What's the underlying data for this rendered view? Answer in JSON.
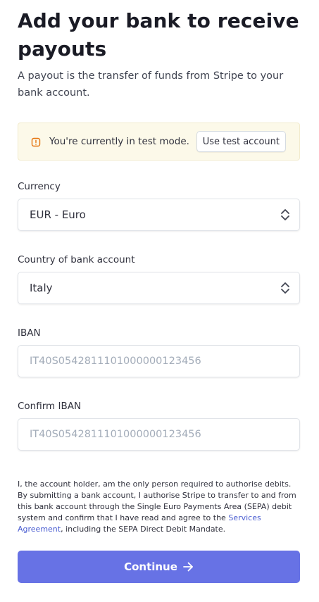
{
  "header": {
    "title": "Add your bank to receive payouts",
    "subtitle": "A payout is the transfer of funds from Stripe to your bank account."
  },
  "notice": {
    "icon": "warning-icon",
    "text": "You're currently in test mode.",
    "button_label": "Use test account",
    "background_color": "#fcf9e9",
    "icon_color": "#e5730c"
  },
  "form": {
    "currency": {
      "label": "Currency",
      "value": "EUR - Euro"
    },
    "country": {
      "label": "Country of bank account",
      "value": "Italy"
    },
    "iban": {
      "label": "IBAN",
      "placeholder": "IT40S0542811101000000123456"
    },
    "confirm_iban": {
      "label": "Confirm IBAN",
      "placeholder": "IT40S0542811101000000123456"
    }
  },
  "legal": {
    "text_before": "I, the account holder, am the only person required to authorise debits. By submitting a bank account, I authorise Stripe to transfer to and from this bank account through the Single Euro Payments Area (SEPA) debit system and confirm that I have read and agree to the ",
    "link_text": "Services Agreement",
    "text_after": ", including the SEPA Direct Debit Mandate."
  },
  "footer": {
    "continue_label": "Continue",
    "button_color": "#6772e5"
  }
}
